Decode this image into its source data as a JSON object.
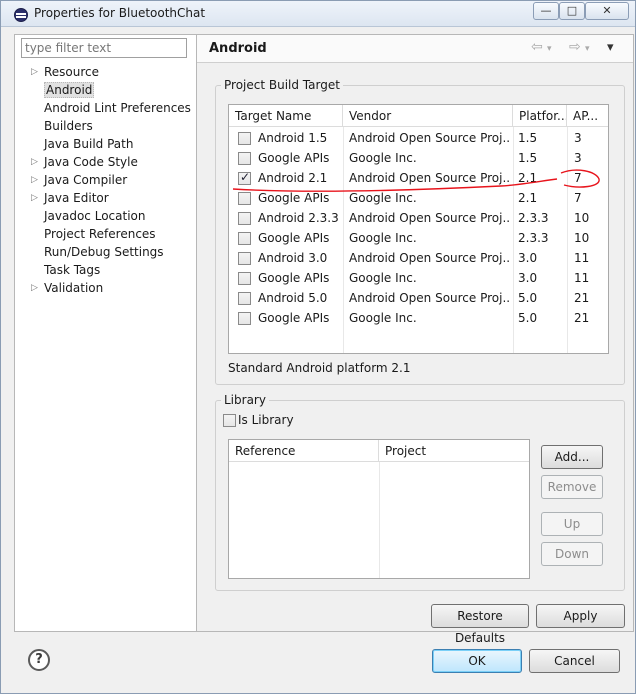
{
  "window": {
    "title": "Properties for BluetoothChat",
    "minimize_glyph": "—",
    "maximize_glyph": "□",
    "close_glyph": "✕"
  },
  "nav": {
    "filter_placeholder": "type filter text",
    "items": [
      {
        "label": "Resource",
        "expandable": true
      },
      {
        "label": "Android",
        "expandable": false,
        "selected": true
      },
      {
        "label": "Android Lint Preferences",
        "expandable": false
      },
      {
        "label": "Builders",
        "expandable": false
      },
      {
        "label": "Java Build Path",
        "expandable": false
      },
      {
        "label": "Java Code Style",
        "expandable": true
      },
      {
        "label": "Java Compiler",
        "expandable": true
      },
      {
        "label": "Java Editor",
        "expandable": true
      },
      {
        "label": "Javadoc Location",
        "expandable": false
      },
      {
        "label": "Project References",
        "expandable": false
      },
      {
        "label": "Run/Debug Settings",
        "expandable": false
      },
      {
        "label": "Task Tags",
        "expandable": false
      },
      {
        "label": "Validation",
        "expandable": true
      }
    ]
  },
  "page": {
    "title": "Android",
    "back_arrow": "⇦",
    "forward_arrow": "⇨",
    "menu_arrow": "▾"
  },
  "build_target": {
    "group_label": "Project Build Target",
    "columns": [
      "Target Name",
      "Vendor",
      "Platfor...",
      "AP..."
    ],
    "rows": [
      {
        "checked": false,
        "name": "Android 1.5",
        "vendor": "Android Open Source Proj...",
        "platform": "1.5",
        "api": "3"
      },
      {
        "checked": false,
        "name": "Google APIs",
        "vendor": "Google Inc.",
        "platform": "1.5",
        "api": "3"
      },
      {
        "checked": true,
        "name": "Android 2.1",
        "vendor": "Android Open Source Proj...",
        "platform": "2.1",
        "api": "7"
      },
      {
        "checked": false,
        "name": "Google APIs",
        "vendor": "Google Inc.",
        "platform": "2.1",
        "api": "7"
      },
      {
        "checked": false,
        "name": "Android 2.3.3",
        "vendor": "Android Open Source Proj...",
        "platform": "2.3.3",
        "api": "10"
      },
      {
        "checked": false,
        "name": "Google APIs",
        "vendor": "Google Inc.",
        "platform": "2.3.3",
        "api": "10"
      },
      {
        "checked": false,
        "name": "Android 3.0",
        "vendor": "Android Open Source Proj...",
        "platform": "3.0",
        "api": "11"
      },
      {
        "checked": false,
        "name": "Google APIs",
        "vendor": "Google Inc.",
        "platform": "3.0",
        "api": "11"
      },
      {
        "checked": false,
        "name": "Android 5.0",
        "vendor": "Android Open Source Proj...",
        "platform": "5.0",
        "api": "21"
      },
      {
        "checked": false,
        "name": "Google APIs",
        "vendor": "Google Inc.",
        "platform": "5.0",
        "api": "21"
      }
    ],
    "description": "Standard Android platform 2.1"
  },
  "library": {
    "group_label": "Library",
    "is_library_label": "Is Library",
    "is_library_checked": false,
    "columns": [
      "Reference",
      "Project"
    ],
    "add_label": "Add...",
    "remove_label": "Remove",
    "up_label": "Up",
    "down_label": "Down"
  },
  "footer": {
    "restore_defaults_label": "Restore Defaults",
    "apply_label": "Apply",
    "ok_label": "OK",
    "cancel_label": "Cancel",
    "help_glyph": "?"
  },
  "colors": {
    "annotation": "#e8141c"
  }
}
